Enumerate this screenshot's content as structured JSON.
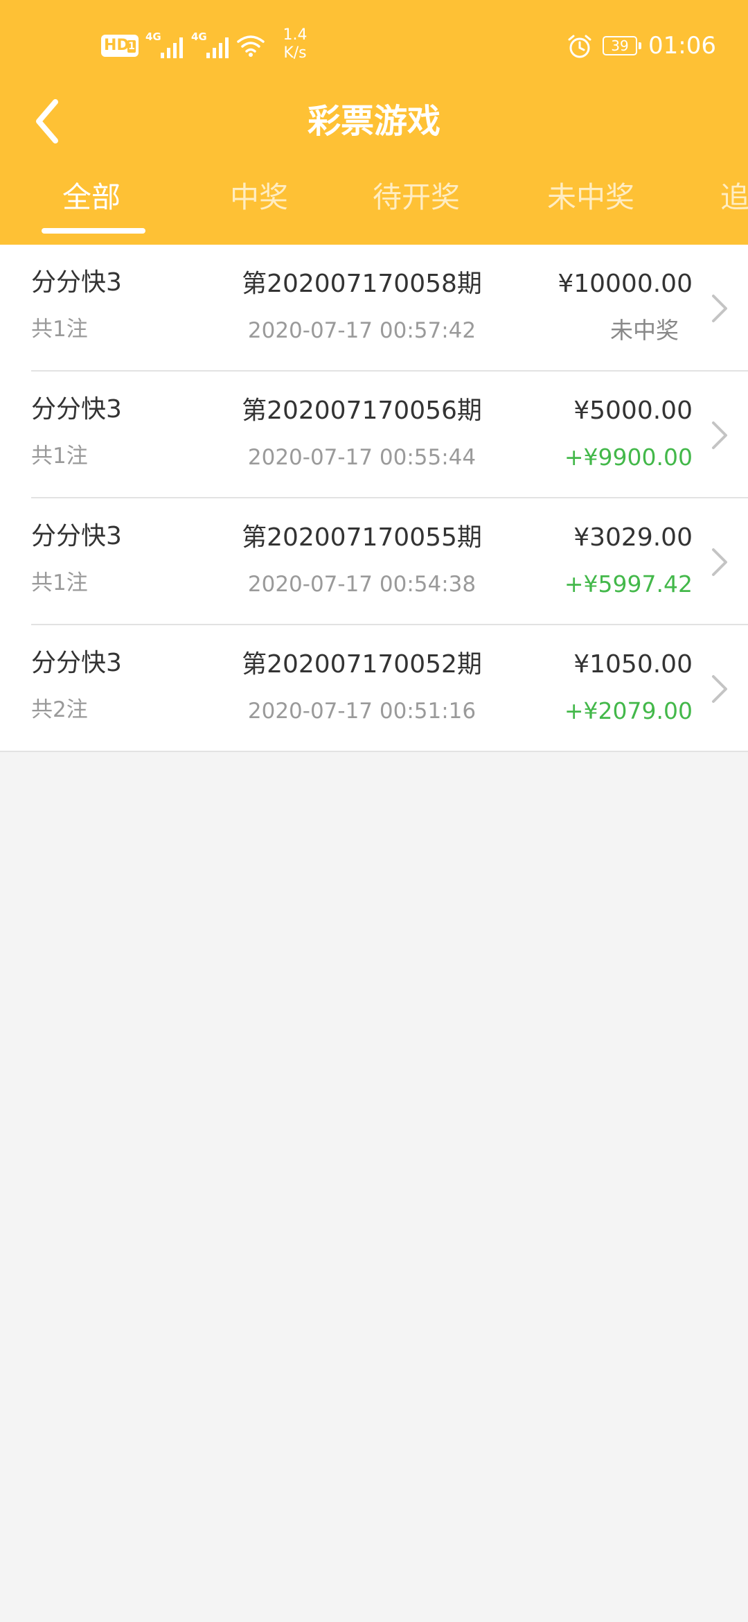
{
  "status_bar": {
    "hd_label": "HD",
    "sim_label": "1",
    "signal_1_label": "4G",
    "signal_2_label": "4G",
    "net_speed_value": "1.4",
    "net_speed_unit": "K/s",
    "battery_level": "39",
    "time": "01:06"
  },
  "nav": {
    "title": "彩票游戏",
    "back_icon": "chevron-left-icon"
  },
  "tabs": [
    {
      "label": "全部",
      "active": true
    },
    {
      "label": "中奖",
      "active": false
    },
    {
      "label": "待开奖",
      "active": false
    },
    {
      "label": "未中奖",
      "active": false
    },
    {
      "label": "追",
      "active": false
    }
  ],
  "colors": {
    "accent": "#fec135",
    "win": "#43b84a",
    "background": "#f4f4f4"
  },
  "records": [
    {
      "game": "分分快3",
      "bets": "共1注",
      "period": "第202007170058期",
      "time": "2020-07-17 00:57:42",
      "amount": "¥10000.00",
      "result": "未中奖",
      "result_type": "lose"
    },
    {
      "game": "分分快3",
      "bets": "共1注",
      "period": "第202007170056期",
      "time": "2020-07-17 00:55:44",
      "amount": "¥5000.00",
      "result": "+¥9900.00",
      "result_type": "win"
    },
    {
      "game": "分分快3",
      "bets": "共1注",
      "period": "第202007170055期",
      "time": "2020-07-17 00:54:38",
      "amount": "¥3029.00",
      "result": "+¥5997.42",
      "result_type": "win"
    },
    {
      "game": "分分快3",
      "bets": "共2注",
      "period": "第202007170052期",
      "time": "2020-07-17 00:51:16",
      "amount": "¥1050.00",
      "result": "+¥2079.00",
      "result_type": "win"
    }
  ]
}
